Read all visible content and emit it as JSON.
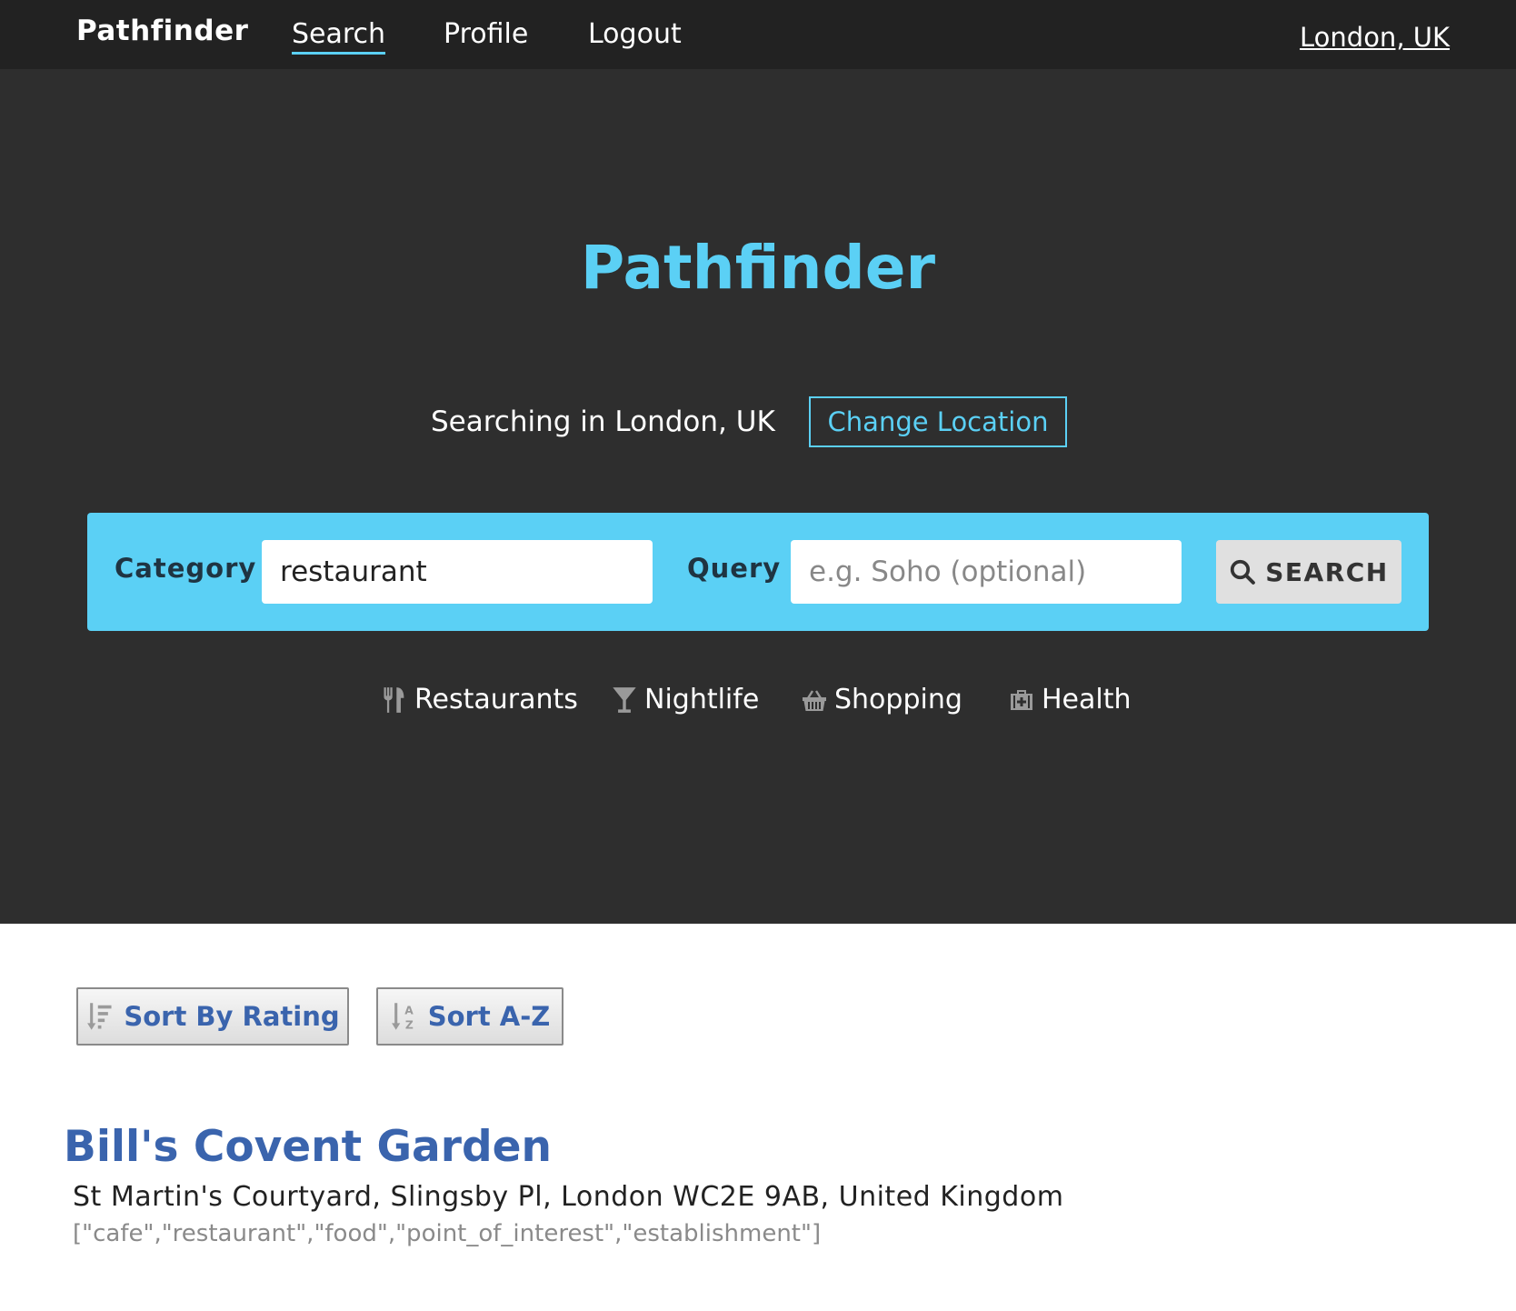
{
  "nav": {
    "brand": "Pathfinder",
    "links": [
      {
        "label": "Search",
        "active": true
      },
      {
        "label": "Profile",
        "active": false
      },
      {
        "label": "Logout",
        "active": false
      }
    ],
    "location": "London, UK"
  },
  "hero": {
    "title": "Pathfinder",
    "searching_text": "Searching in London, UK",
    "change_location_label": "Change Location"
  },
  "search": {
    "category_label": "Category",
    "category_value": "restaurant",
    "query_label": "Query",
    "query_placeholder": "e.g. Soho (optional)",
    "button_label": "SEARCH"
  },
  "quick_categories": [
    {
      "label": "Restaurants",
      "icon": "utensils-icon"
    },
    {
      "label": "Nightlife",
      "icon": "cocktail-glass-icon"
    },
    {
      "label": "Shopping",
      "icon": "shopping-basket-icon"
    },
    {
      "label": "Health",
      "icon": "medkit-icon"
    }
  ],
  "sort": {
    "rating_label": "Sort By Rating",
    "az_label": "Sort A-Z"
  },
  "results": [
    {
      "name": "Bill's Covent Garden",
      "address": "St Martin's Courtyard, Slingsby Pl, London WC2E 9AB, United Kingdom",
      "types": "[\"cafe\",\"restaurant\",\"food\",\"point_of_interest\",\"establishment\"]"
    }
  ],
  "colors": {
    "accent": "#5bd0f5",
    "nav_bg": "#222222",
    "hero_bg": "#2e2e2e",
    "link_blue": "#3a64ad"
  }
}
